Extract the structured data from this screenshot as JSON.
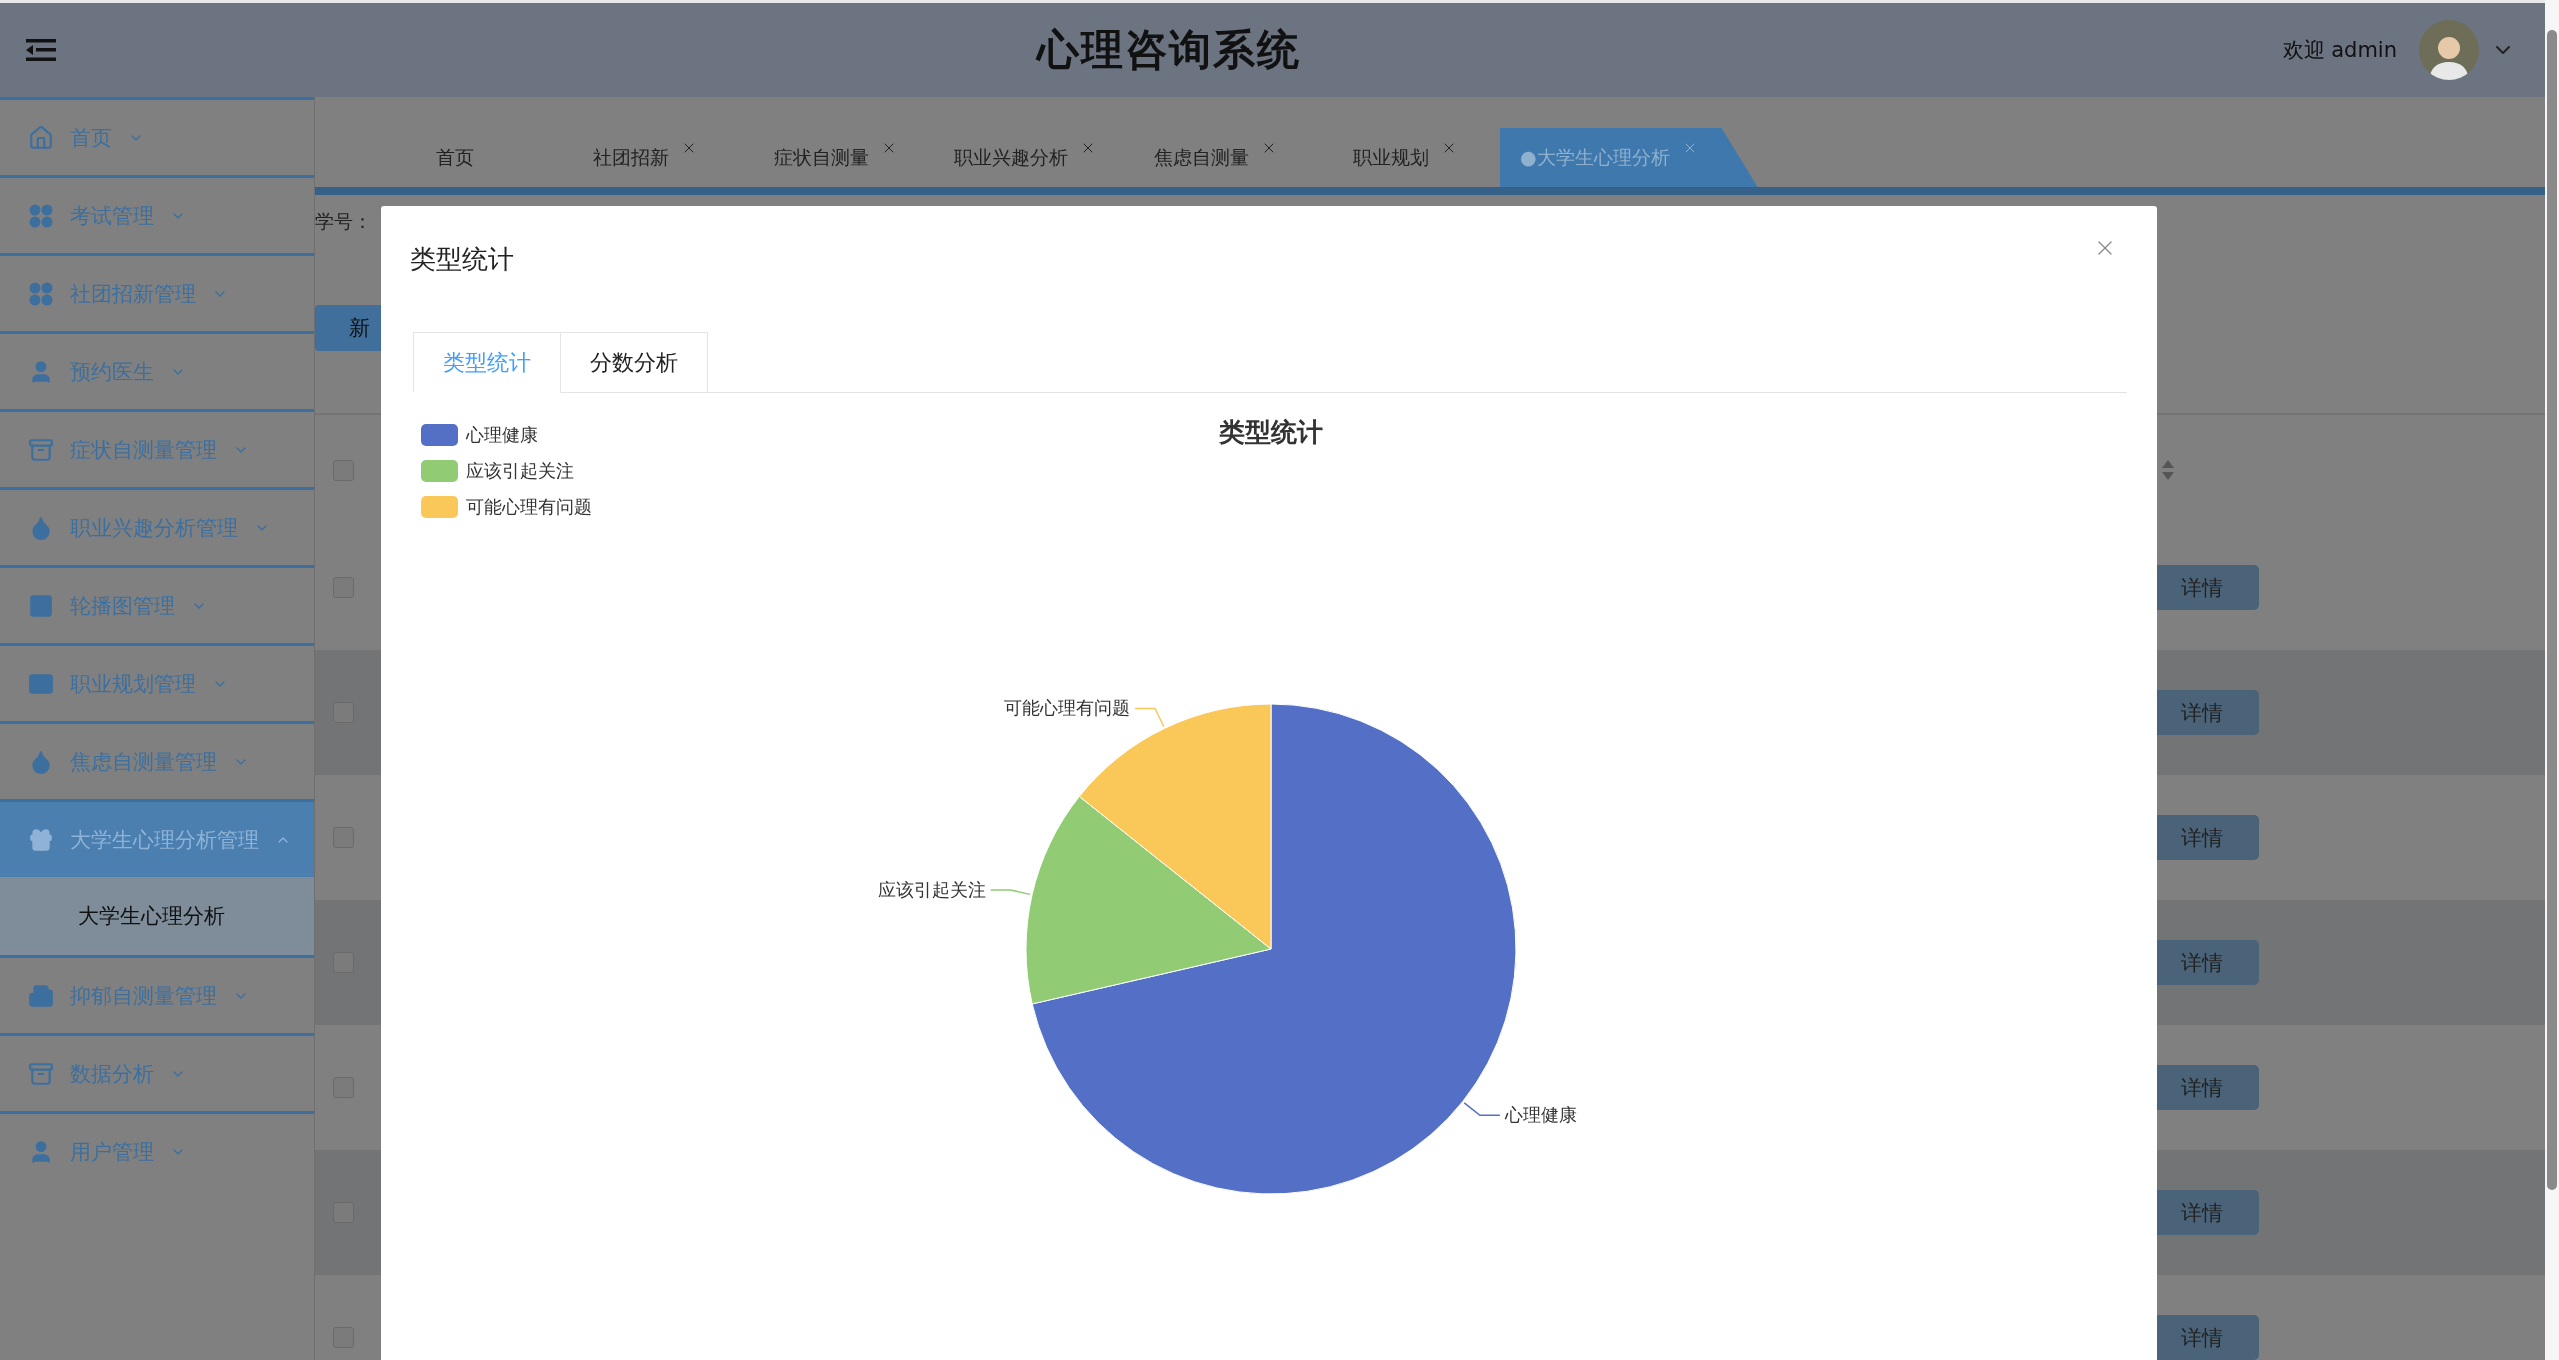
{
  "header": {
    "title": "心理咨询系统",
    "welcome": "欢迎 admin"
  },
  "sidebar": {
    "items": [
      {
        "label": "首页",
        "expanded": false,
        "selected": false
      },
      {
        "label": "考试管理",
        "expanded": false,
        "selected": false
      },
      {
        "label": "社团招新管理",
        "expanded": false,
        "selected": false
      },
      {
        "label": "预约医生",
        "expanded": false,
        "selected": false
      },
      {
        "label": "症状自测量管理",
        "expanded": false,
        "selected": false
      },
      {
        "label": "职业兴趣分析管理",
        "expanded": false,
        "selected": false
      },
      {
        "label": "轮播图管理",
        "expanded": false,
        "selected": false
      },
      {
        "label": "职业规划管理",
        "expanded": false,
        "selected": false
      },
      {
        "label": "焦虑自测量管理",
        "expanded": false,
        "selected": false
      },
      {
        "label": "大学生心理分析管理",
        "expanded": true,
        "selected": true,
        "children": [
          {
            "label": "大学生心理分析",
            "selected": true
          }
        ]
      },
      {
        "label": "抑郁自测量管理",
        "expanded": false,
        "selected": false
      },
      {
        "label": "数据分析",
        "expanded": false,
        "selected": false
      },
      {
        "label": "用户管理",
        "expanded": false,
        "selected": false
      }
    ]
  },
  "tabs": [
    {
      "label": "首页",
      "closable": false,
      "selected": false
    },
    {
      "label": "社团招新",
      "closable": true,
      "selected": false
    },
    {
      "label": "症状自测量",
      "closable": true,
      "selected": false
    },
    {
      "label": "职业兴趣分析",
      "closable": true,
      "selected": false
    },
    {
      "label": "焦虑自测量",
      "closable": true,
      "selected": false
    },
    {
      "label": "职业规划",
      "closable": true,
      "selected": false
    },
    {
      "label": "●大学生心理分析",
      "closable": true,
      "selected": true
    }
  ],
  "filter": {
    "label": "学号：",
    "add_button": "新"
  },
  "table": {
    "header_checked": false,
    "rows": [
      {
        "checked": false,
        "action": "详情"
      },
      {
        "checked": false,
        "action": "详情"
      },
      {
        "checked": false,
        "action": "详情"
      },
      {
        "checked": false,
        "action": "详情"
      },
      {
        "checked": false,
        "action": "详情"
      },
      {
        "checked": false,
        "action": "详情"
      },
      {
        "checked": false,
        "action": "详情"
      }
    ]
  },
  "modal": {
    "title": "类型统计",
    "tabs": [
      {
        "label": "类型统计",
        "selected": true
      },
      {
        "label": "分数分析",
        "selected": false
      }
    ],
    "legend": [
      {
        "label": "心理健康",
        "color": "#5470c6"
      },
      {
        "label": "应该引起关注",
        "color": "#91cc75"
      },
      {
        "label": "可能心理有问题",
        "color": "#fac858"
      }
    ],
    "chart_data": {
      "type": "pie",
      "title": "类型统计",
      "categories": [
        "心理健康",
        "应该引起关注",
        "可能心理有问题"
      ],
      "values": [
        71.4,
        14.3,
        14.3
      ]
    }
  }
}
